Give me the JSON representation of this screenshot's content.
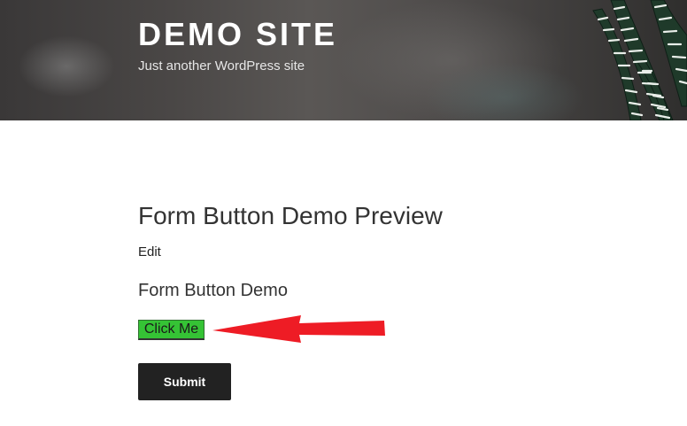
{
  "header": {
    "site_title": "DEMO SITE",
    "tagline": "Just another WordPress site"
  },
  "main": {
    "page_title": "Form Button Demo Preview",
    "edit_link": "Edit",
    "form_heading": "Form Button Demo",
    "click_me_label": "Click Me",
    "submit_label": "Submit"
  },
  "colors": {
    "click_me_bg": "#35c335",
    "submit_bg": "#222222",
    "arrow": "#ee1c25"
  },
  "icons": [
    "plant-image",
    "red-arrow-annotation"
  ]
}
